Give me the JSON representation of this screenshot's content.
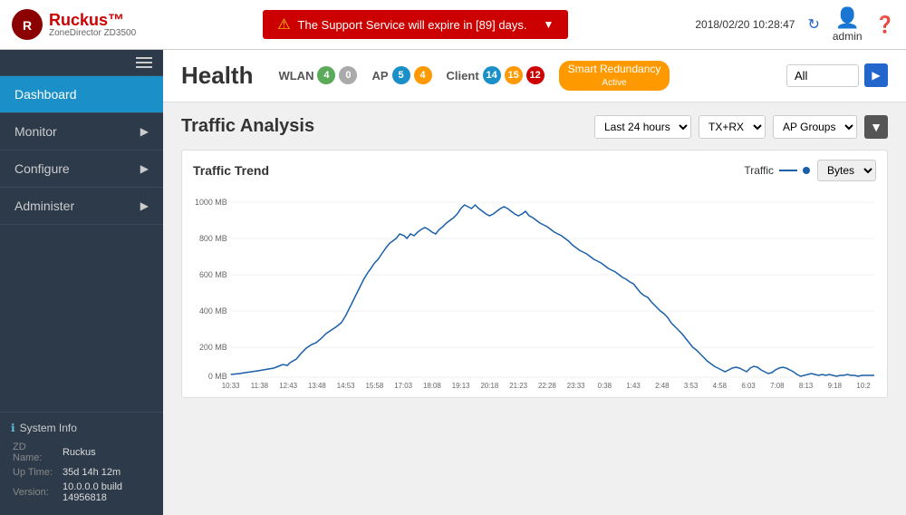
{
  "header": {
    "logo_name": "Ruckus™",
    "logo_sub": "ZoneDirector  ZD3500",
    "alert_text": "The Support Service will expire in [89] days.",
    "datetime": "2018/02/20  10:28:47",
    "admin_label": "admin"
  },
  "sidebar": {
    "hamburger_label": "menu",
    "items": [
      {
        "label": "Dashboard",
        "active": true,
        "has_arrow": false
      },
      {
        "label": "Monitor",
        "active": false,
        "has_arrow": true
      },
      {
        "label": "Configure",
        "active": false,
        "has_arrow": true
      },
      {
        "label": "Administer",
        "active": false,
        "has_arrow": true
      }
    ],
    "system_info": {
      "title": "System Info",
      "zd_name_label": "ZD Name:",
      "zd_name_value": "Ruckus",
      "uptime_label": "Up Time:",
      "uptime_value": "35d 14h 12m",
      "version_label": "Version:",
      "version_value": "10.0.0.0 build 14956818"
    }
  },
  "health": {
    "title": "Health",
    "wlan_label": "WLAN",
    "wlan_green": "4",
    "wlan_gray": "0",
    "ap_label": "AP",
    "ap_blue": "5",
    "ap_orange": "4",
    "client_label": "Client",
    "client_blue": "14",
    "client_orange": "15",
    "client_red": "12",
    "smart_redundancy_label": "Smart Redundancy",
    "smart_redundancy_status": "Active",
    "filter_default": "All",
    "play_icon": "▶"
  },
  "traffic": {
    "title": "Traffic Analysis",
    "time_filter": "Last 24 hours",
    "direction_filter": "TX+RX",
    "group_filter": "AP Groups",
    "chart_title": "Traffic Trend",
    "bytes_filter": "Bytes",
    "legend_label": "Traffic",
    "y_labels": [
      "1000 MB",
      "800 MB",
      "600 MB",
      "400 MB",
      "200 MB",
      "0 MB"
    ],
    "x_labels": [
      "10:33",
      "11:38",
      "12:43",
      "13:48",
      "14:53",
      "15:58",
      "17:03",
      "18:08",
      "19:13",
      "20:18",
      "21:23",
      "22:28",
      "23:33",
      "0:38",
      "1:43",
      "2:48",
      "3:53",
      "4:58",
      "6:03",
      "7:08",
      "8:13",
      "9:18",
      "10:2"
    ]
  }
}
